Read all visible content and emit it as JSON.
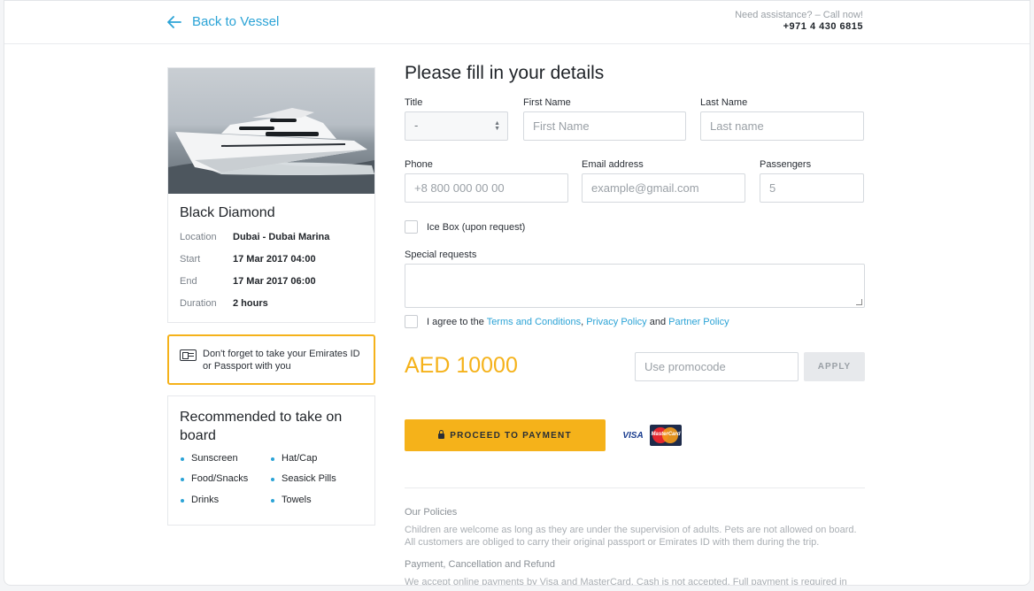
{
  "header": {
    "back_label": "Back to Vessel",
    "assist_text": "Need assistance? – Call now!",
    "phone": "+971 4 430 6815"
  },
  "vessel": {
    "name": "Black Diamond",
    "details": [
      {
        "label": "Location",
        "value": "Dubai - Dubai Marina"
      },
      {
        "label": "Start",
        "value": "17 Mar 2017 04:00"
      },
      {
        "label": "End",
        "value": "17 Mar 2017 06:00"
      },
      {
        "label": "Duration",
        "value": "2 hours"
      }
    ]
  },
  "notice": {
    "text": "Don't forget to take your Emirates ID or Passport with you"
  },
  "recommend": {
    "title": "Recommended to take on board",
    "items": [
      "Sunscreen",
      "Hat/Cap",
      "Food/Snacks",
      "Seasick Pills",
      "Drinks",
      "Towels"
    ]
  },
  "form": {
    "title": "Please fill in your details",
    "title_label": "Title",
    "title_value": "-",
    "first_name_label": "First Name",
    "first_name_placeholder": "First Name",
    "last_name_label": "Last Name",
    "last_name_placeholder": "Last name",
    "phone_label": "Phone",
    "phone_placeholder": "+8 800 000 00 00",
    "email_label": "Email address",
    "email_placeholder": "example@gmail.com",
    "passengers_label": "Passengers",
    "passengers_placeholder": "5",
    "icebox_label": "Ice Box (upon request)",
    "special_label": "Special requests",
    "agree_prefix": "I agree to the",
    "terms": "Terms and Conditions",
    "comma": ",",
    "privacy": "Privacy Policy",
    "and": "and",
    "partner": "Partner Policy",
    "price": "AED 10000",
    "promo_placeholder": "Use promocode",
    "apply_label": "APPLY",
    "pay_label": "PROCEED TO PAYMENT",
    "visa_label": "VISA",
    "mastercard_label": "MasterCard"
  },
  "policies": {
    "title": "Our Policies",
    "text": "Children are welcome as long as they are under the supervision of adults. Pets are not allowed on board. All customers are obliged to carry their original passport or Emirates ID with them during the trip.",
    "payment_title": "Payment, Cancellation and Refund",
    "payment_text": "We accept online payments by Visa and MasterCard. Cash is not accepted. Full payment is required in order to"
  },
  "colors": {
    "accent": "#2ba3d6",
    "primary_button": "#f5b21a",
    "price": "#f5b21a"
  }
}
